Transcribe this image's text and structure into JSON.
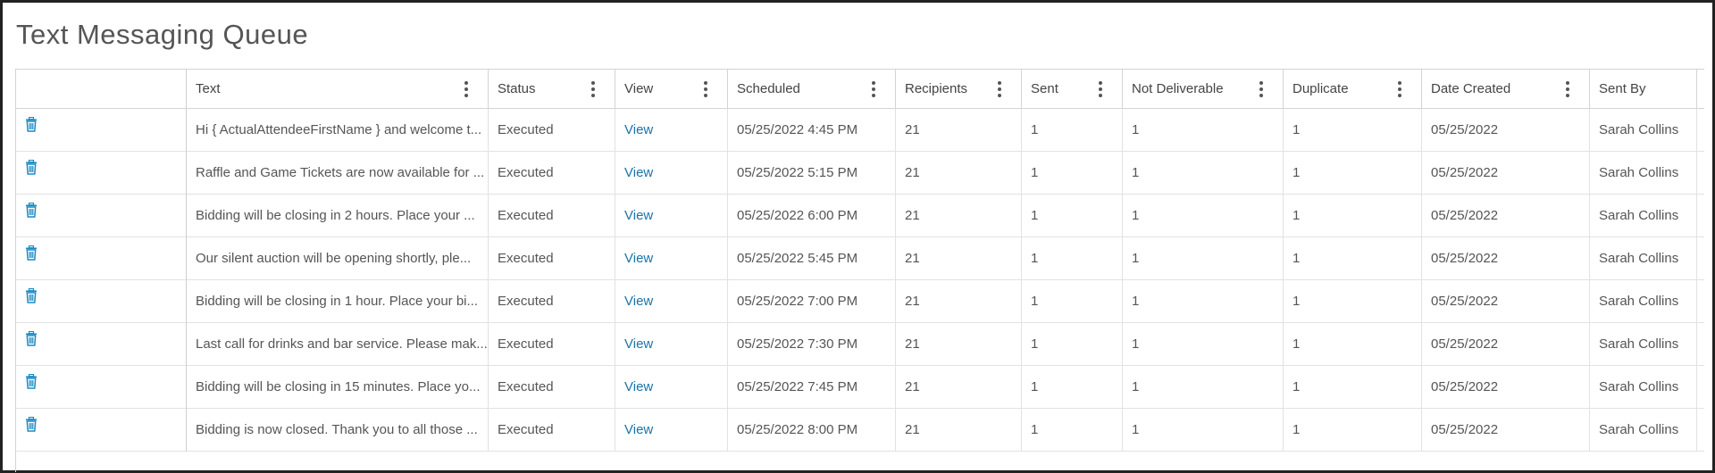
{
  "page": {
    "title": "Text Messaging Queue"
  },
  "grid": {
    "columns": [
      {
        "key": "actions",
        "label": ""
      },
      {
        "key": "text",
        "label": "Text"
      },
      {
        "key": "status",
        "label": "Status"
      },
      {
        "key": "view",
        "label": "View"
      },
      {
        "key": "scheduled",
        "label": "Scheduled"
      },
      {
        "key": "recipients",
        "label": "Recipients"
      },
      {
        "key": "sent",
        "label": "Sent"
      },
      {
        "key": "not_deliverable",
        "label": "Not Deliverable"
      },
      {
        "key": "duplicate",
        "label": "Duplicate"
      },
      {
        "key": "date_created",
        "label": "Date Created"
      },
      {
        "key": "sent_by",
        "label": "Sent By"
      }
    ],
    "rows": [
      {
        "text": "Hi { ActualAttendeeFirstName } and welcome t...",
        "status": "Executed",
        "view": "View",
        "scheduled": "05/25/2022 4:45 PM",
        "recipients": "21",
        "sent": "1",
        "not_deliverable": "1",
        "duplicate": "1",
        "date_created": "05/25/2022",
        "sent_by": "Sarah Collins"
      },
      {
        "text": "Raffle and Game Tickets are now available for ...",
        "status": "Executed",
        "view": "View",
        "scheduled": "05/25/2022 5:15 PM",
        "recipients": "21",
        "sent": "1",
        "not_deliverable": "1",
        "duplicate": "1",
        "date_created": "05/25/2022",
        "sent_by": "Sarah Collins"
      },
      {
        "text": "Bidding will be closing in 2 hours. Place your ...",
        "status": "Executed",
        "view": "View",
        "scheduled": "05/25/2022 6:00 PM",
        "recipients": "21",
        "sent": "1",
        "not_deliverable": "1",
        "duplicate": "1",
        "date_created": "05/25/2022",
        "sent_by": "Sarah Collins"
      },
      {
        "text": "Our silent auction will be opening shortly, ple...",
        "status": "Executed",
        "view": "View",
        "scheduled": "05/25/2022 5:45 PM",
        "recipients": "21",
        "sent": "1",
        "not_deliverable": "1",
        "duplicate": "1",
        "date_created": "05/25/2022",
        "sent_by": "Sarah Collins"
      },
      {
        "text": "Bidding will be closing in 1 hour. Place your bi...",
        "status": "Executed",
        "view": "View",
        "scheduled": "05/25/2022 7:00 PM",
        "recipients": "21",
        "sent": "1",
        "not_deliverable": "1",
        "duplicate": "1",
        "date_created": "05/25/2022",
        "sent_by": "Sarah Collins"
      },
      {
        "text": "Last call for drinks and bar service. Please mak...",
        "status": "Executed",
        "view": "View",
        "scheduled": "05/25/2022 7:30 PM",
        "recipients": "21",
        "sent": "1",
        "not_deliverable": "1",
        "duplicate": "1",
        "date_created": "05/25/2022",
        "sent_by": "Sarah Collins"
      },
      {
        "text": "Bidding will be closing in 15 minutes. Place yo...",
        "status": "Executed",
        "view": "View",
        "scheduled": "05/25/2022 7:45 PM",
        "recipients": "21",
        "sent": "1",
        "not_deliverable": "1",
        "duplicate": "1",
        "date_created": "05/25/2022",
        "sent_by": "Sarah Collins"
      },
      {
        "text": "Bidding is now closed. Thank you to all those ...",
        "status": "Executed",
        "view": "View",
        "scheduled": "05/25/2022 8:00 PM",
        "recipients": "21",
        "sent": "1",
        "not_deliverable": "1",
        "duplicate": "1",
        "date_created": "05/25/2022",
        "sent_by": "Sarah Collins"
      }
    ],
    "icons": {
      "delete": "trash-icon",
      "column_menu": "kebab-menu-icon"
    },
    "colors": {
      "link": "#1a73a8",
      "icon": "#1a8ac4",
      "border": "#d4d4d4"
    }
  }
}
